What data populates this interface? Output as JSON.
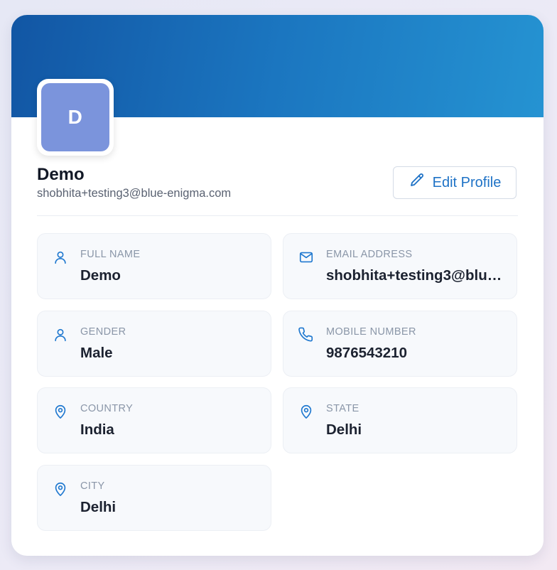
{
  "profile": {
    "avatar_initial": "D",
    "name": "Demo",
    "email": "shobhita+testing3@blue-enigma.com",
    "edit_label": "Edit Profile"
  },
  "colors": {
    "banner_start": "#1256a4",
    "banner_end": "#2593d2",
    "accent": "#1e72c6",
    "avatar_bg": "#7b94dc"
  },
  "fields": [
    {
      "icon": "user-icon",
      "label": "FULL NAME",
      "value": "Demo"
    },
    {
      "icon": "mail-icon",
      "label": "EMAIL ADDRESS",
      "value": "shobhita+testing3@blue-enigma.com"
    },
    {
      "icon": "user-icon",
      "label": "GENDER",
      "value": "Male"
    },
    {
      "icon": "phone-icon",
      "label": "MOBILE NUMBER",
      "value": "9876543210"
    },
    {
      "icon": "map-pin-icon",
      "label": "COUNTRY",
      "value": "India"
    },
    {
      "icon": "map-pin-icon",
      "label": "STATE",
      "value": "Delhi"
    },
    {
      "icon": "map-pin-icon",
      "label": "CITY",
      "value": "Delhi"
    }
  ]
}
